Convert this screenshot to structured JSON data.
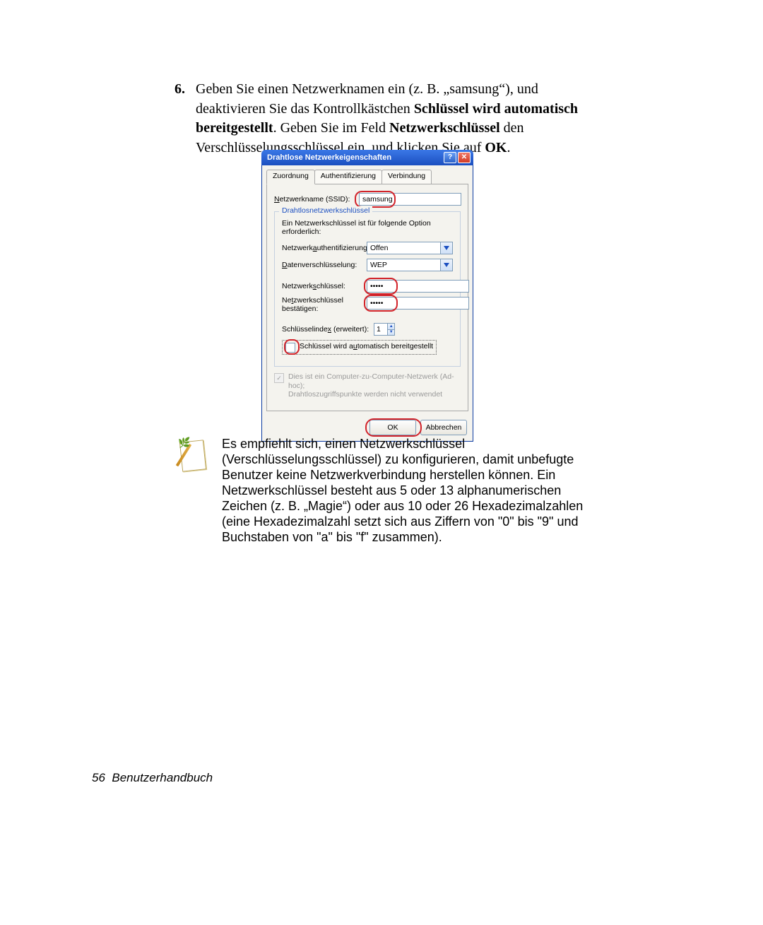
{
  "instruction": {
    "number": "6.",
    "pre": "Geben Sie einen Netzwerknamen ein (z. B. „samsung“), und deaktivieren Sie das Kontrollkästchen ",
    "bold1": "Schlüssel wird automatisch bereitgestellt",
    "mid": ". Geben Sie im Feld ",
    "bold2": "Netzwerkschlüssel",
    "tail": " den Verschlüsselungsschlüssel ein, und klicken Sie auf ",
    "bold3": "OK",
    "end": "."
  },
  "dialog": {
    "title": "Drahtlose Netzwerkeigenschaften",
    "tabs": [
      "Zuordnung",
      "Authentifizierung",
      "Verbindung"
    ],
    "ssid_label": "Netzwerkname (SSID):",
    "ssid_value": "samsung",
    "fieldset_legend": "Drahtlosnetzwerkschlüssel",
    "fieldset_note": "Ein Netzwerkschlüssel ist für folgende Option erforderlich:",
    "auth_label": "Netzwerkauthentifizierung:",
    "auth_value": "Offen",
    "enc_label": "Datenverschlüsselung:",
    "enc_value": "WEP",
    "key_label": "Netzwerkschlüssel:",
    "key_value": "•••••",
    "key2_label_line1": "Netzwerkschlüssel",
    "key2_label_line2": "bestätigen:",
    "key2_value": "•••••",
    "index_label": "Schlüsselindex (erweitert):",
    "index_value": "1",
    "auto_key_label": "Schlüssel wird automatisch bereitgestellt",
    "adhoc_line1": "Dies ist ein Computer-zu-Computer-Netzwerk (Ad-hoc);",
    "adhoc_line2": "Drahtloszugriffspunkte werden nicht verwendet",
    "ok": "OK",
    "cancel": "Abbrechen"
  },
  "note": {
    "text": "Es empfiehlt sich, einen Netzwerkschlüssel (Verschlüsselungsschlüssel) zu konfigurieren, damit unbefugte Benutzer keine Netzwerkverbindung herstellen können. Ein Netzwerkschlüssel besteht aus 5 oder 13 alphanumerischen Zeichen (z. B. „Magie“) oder aus 10 oder 26 Hexadezimalzahlen (eine Hexadezimalzahl setzt sich aus Ziffern von \"0\" bis \"9\" und Buchstaben von \"a\" bis \"f\" zusammen)."
  },
  "footer": {
    "page": "56",
    "label": "Benutzerhandbuch"
  }
}
